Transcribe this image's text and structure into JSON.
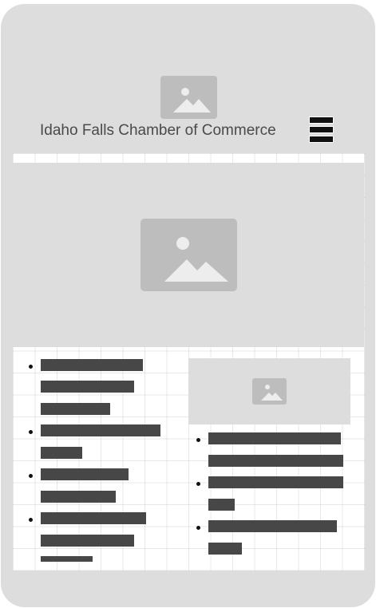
{
  "header": {
    "title": "Idaho Falls Chamber of Commerce",
    "logo_icon": "image-placeholder-icon",
    "menu_icon": "hamburger-menu-icon"
  },
  "hero": {
    "icon": "image-placeholder-icon"
  },
  "left_list": {
    "items": [
      {
        "name": "left-list-item-1"
      },
      {
        "name": "left-list-item-2"
      },
      {
        "name": "left-list-item-3"
      },
      {
        "name": "left-list-item-4"
      }
    ]
  },
  "right_column": {
    "card_icon": "image-placeholder-icon",
    "items": [
      {
        "name": "right-list-item-1"
      },
      {
        "name": "right-list-item-2"
      },
      {
        "name": "right-list-item-3"
      }
    ]
  },
  "colors": {
    "device_background": "#dddddd",
    "placeholder": "#bdbdbd",
    "text_bar": "#474747",
    "menu_icon": "#111111",
    "grid_background": "#ffffff"
  }
}
